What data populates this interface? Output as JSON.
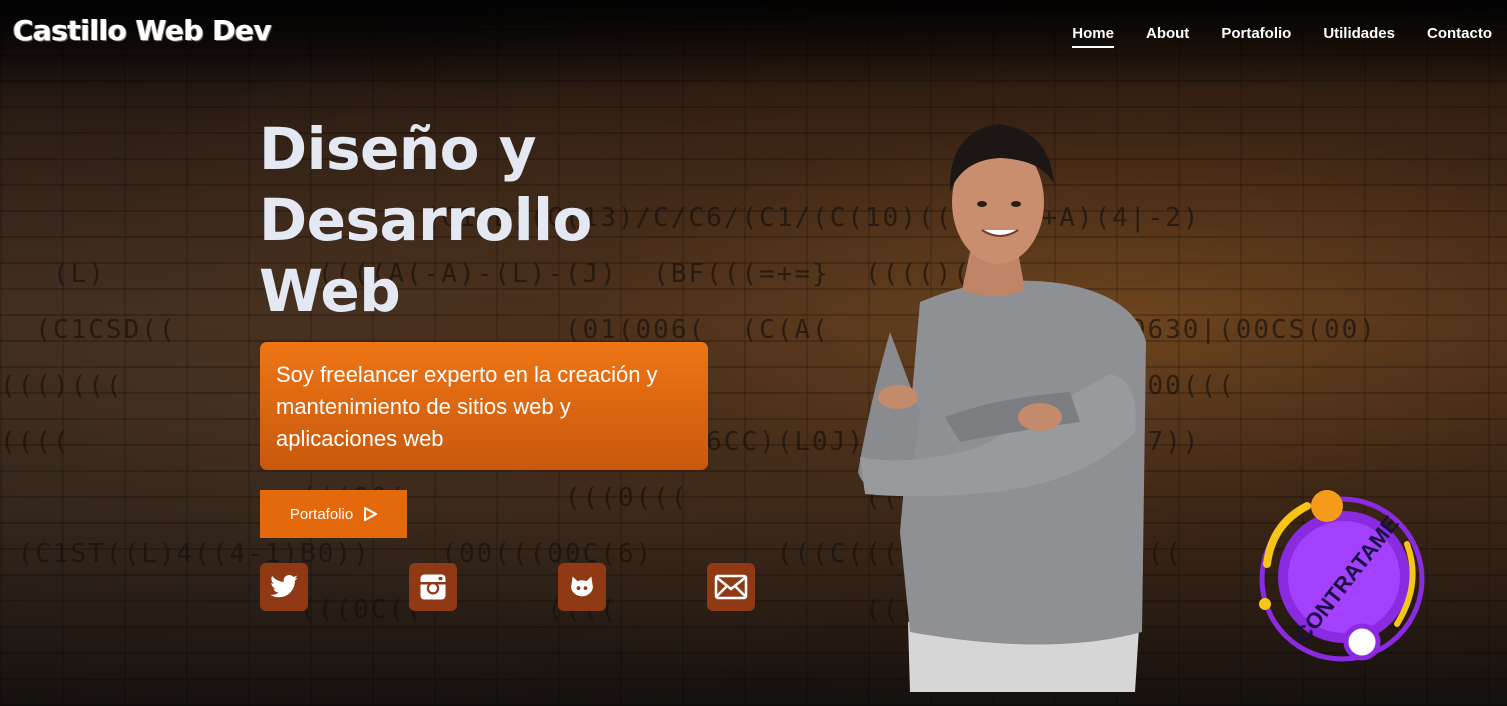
{
  "brand": {
    "logo": "Castillo Web Dev"
  },
  "nav": {
    "items": [
      {
        "label": "Home",
        "active": true
      },
      {
        "label": "About",
        "active": false
      },
      {
        "label": "Portafolio",
        "active": false
      },
      {
        "label": "Utilidades",
        "active": false
      },
      {
        "label": "Contacto",
        "active": false
      }
    ]
  },
  "hero": {
    "title_line1": "Diseño y",
    "title_line2": "Desarrollo",
    "title_line3": "Web",
    "description": "Soy freelancer experto en la creación y mantenimiento de sitios web y aplicaciones web",
    "cta_label": "Portafolio",
    "cta_icon": "play-icon"
  },
  "socials": [
    {
      "name": "twitter-icon"
    },
    {
      "name": "instagram-icon"
    },
    {
      "name": "github-icon"
    },
    {
      "name": "email-icon"
    }
  ],
  "badge": {
    "text": "CONTRATAME"
  },
  "colors": {
    "accent": "#ee7616",
    "accent_dark": "#c9580c",
    "social_bg": "#8f3a14",
    "badge_purple": "#8a2be2",
    "badge_yellow": "#f5c518"
  }
}
